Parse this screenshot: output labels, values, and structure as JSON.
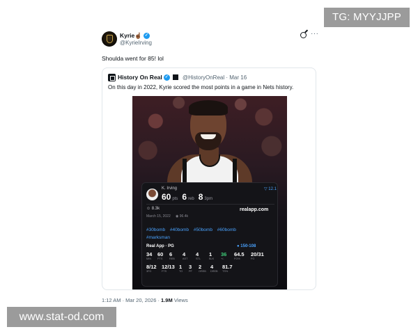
{
  "watermarks": {
    "tg": "TG: MYYJJPP",
    "site": "www.stat-od.com"
  },
  "tweet": {
    "author_name": "Kyrie☝🏾",
    "handle": "@KyrieIrving",
    "text": "Shoulda went for 85! lol",
    "footer_time": "1:12 AM · Mar 20, 2026 · ",
    "footer_views_count": "1.9M",
    "footer_views_label": " Views"
  },
  "quote": {
    "author_name": "History On Real",
    "handle": "@HistoryOnReal",
    "date": "· Mar 16",
    "text": "On this day in 2022, Kyrie scored the most points in a game in Nets history."
  },
  "card": {
    "player_name": "K. Irving",
    "pts_value": "60",
    "pts_unit": "pts",
    "reb_value": "6",
    "reb_unit": "reb",
    "threes_value": "8",
    "threes_unit": "3pm",
    "rating": "▽ 12.1",
    "likes": "8.3k",
    "site": "realapp.com",
    "date": "March 15, 2022",
    "views": "96.4k",
    "tags": [
      "#30bomb",
      "#40bomb",
      "#50bomb",
      "#60bomb",
      "#marksman"
    ],
    "source": "Real App · PG",
    "score": "150-108",
    "row1": [
      {
        "v": "34",
        "l": "MIN"
      },
      {
        "v": "60",
        "l": "PTS"
      },
      {
        "v": "6",
        "l": "REB"
      },
      {
        "v": "4",
        "l": "AST"
      },
      {
        "v": "4",
        "l": "STL"
      },
      {
        "v": "1",
        "l": "BLK"
      },
      {
        "v": "36",
        "l": "+/-"
      },
      {
        "v": "64.5",
        "l": "FG%"
      },
      {
        "v": "20/31",
        "l": "FG"
      }
    ],
    "row2": [
      {
        "v": "8/12",
        "l": "3FG"
      },
      {
        "v": "12/13",
        "l": "FTS"
      },
      {
        "v": "1",
        "l": "TO"
      },
      {
        "v": "3",
        "l": "PF"
      },
      {
        "v": "2",
        "l": "OREB"
      },
      {
        "v": "4",
        "l": "DREB"
      },
      {
        "v": "81.7",
        "l": "TS%"
      }
    ]
  }
}
